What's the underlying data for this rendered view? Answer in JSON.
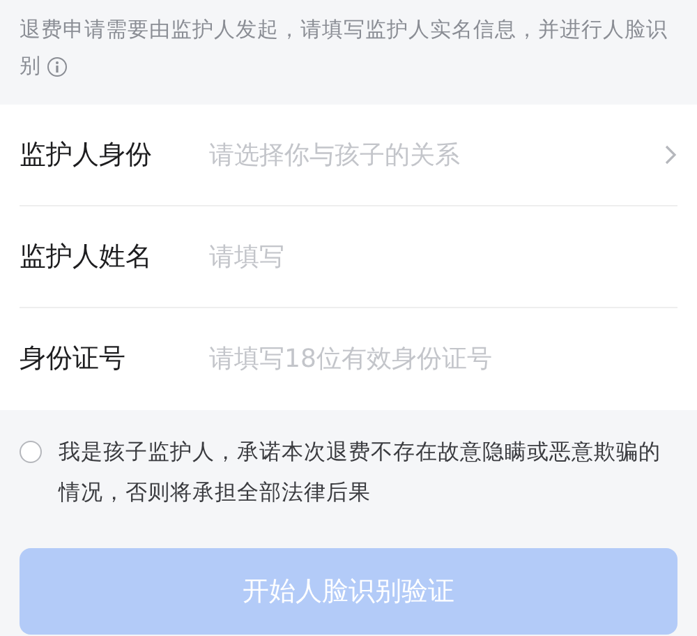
{
  "notice": {
    "text": "退费申请需要由监护人发起，请填写监护人实名信息，并进行人脸识别"
  },
  "fields": [
    {
      "kind": "select",
      "label": "监护人身份",
      "placeholder": "请选择你与孩子的关系"
    },
    {
      "kind": "input",
      "label": "监护人姓名",
      "placeholder": "请填写"
    },
    {
      "kind": "input",
      "label": "身份证号",
      "placeholder": "请填写18位有效身份证号"
    }
  ],
  "agreement": {
    "checked": false,
    "text": "我是孩子监护人，承诺本次退费不存在故意隐瞒或恶意欺骗的情况，否则将承担全部法律后果"
  },
  "submit": {
    "label": "开始人脸识别验证",
    "disabled": true
  }
}
